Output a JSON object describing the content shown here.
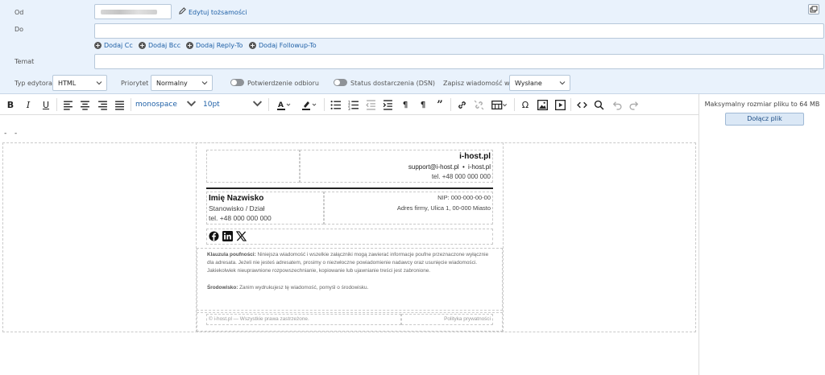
{
  "header": {
    "from_label": "Od",
    "to_label": "Do",
    "subject_label": "Temat",
    "edit_identities": "Edytuj tożsamości",
    "add_cc": "Dodaj Cc",
    "add_bcc": "Dodaj Bcc",
    "add_reply_to": "Dodaj Reply-To",
    "add_followup_to": "Dodaj Followup-To",
    "to_value": "",
    "subject_value": ""
  },
  "options": {
    "editor_type_label": "Typ edytora",
    "editor_type_value": "HTML",
    "priority_label": "Priorytet",
    "priority_value": "Normalny",
    "read_receipt_label": "Potwierdzenie odbioru",
    "read_receipt_on": false,
    "dsn_label": "Status dostarczenia (DSN)",
    "dsn_on": false,
    "save_in_label": "Zapisz wiadomość w",
    "save_in_value": "Wysłane"
  },
  "toolbar": {
    "font_family": "monospace",
    "font_size": "10pt",
    "icons": [
      "bold-icon",
      "italic-icon",
      "underline-icon",
      "align-left-icon",
      "align-center-icon",
      "align-right-icon",
      "justify-icon",
      "text-color-icon",
      "highlight-icon",
      "bullet-list-icon",
      "numbered-list-icon",
      "outdent-icon",
      "indent-icon",
      "ltr-icon",
      "rtl-icon",
      "blockquote-icon",
      "link-icon",
      "unlink-icon",
      "table-icon",
      "special-char-icon",
      "image-icon",
      "media-icon",
      "source-code-icon",
      "search-icon",
      "undo-icon",
      "redo-icon"
    ]
  },
  "editor": {
    "signature_separator": "- -",
    "company": "i-host.pl",
    "support_email": "support@i-host.pl",
    "bullet": "•",
    "site": "i-host.pl",
    "company_phone": "tel. +48 000 000 000",
    "name": "Imię Nazwisko",
    "position": "Stanowisko / Dział",
    "phone": "tel. +48 000 000 000",
    "nip": "NIP: 000-000-00-00",
    "address": "Adres firmy, Ulica 1, 00-000 Miasto",
    "social_icons": [
      "facebook-icon",
      "linkedin-icon",
      "x-icon"
    ],
    "disclaimer_title": "Klauzula poufności:",
    "disclaimer_text": "Niniejsza wiadomość i wszelkie załączniki mogą zawierać informacje poufne przeznaczone wyłącznie dla adresata. Jeżeli nie jesteś adresatem, prosimy o niezwłoczne powiadomienie nadawcy oraz usunięcie wiadomości. Jakiekolwiek nieuprawnione rozpowszechnianie, kopiowanie lub ujawnianie treści jest zabronione.",
    "env_title": "Środowisko:",
    "env_text": "Zanim wydrukujesz tę wiadomość, pomyśl o środowisku.",
    "footer_left": "© i-host.pl — Wszystkie prawa zastrzeżone.",
    "footer_right": "Polityka prywatności"
  },
  "sidebar": {
    "max_size": "Maksymalny rozmiar pliku to 64 MB",
    "attach_button": "Dołącz plik"
  },
  "colors": {
    "header_bg": "#e9f2fc",
    "link": "#2061a7",
    "button_bg": "#dbe8f6"
  }
}
